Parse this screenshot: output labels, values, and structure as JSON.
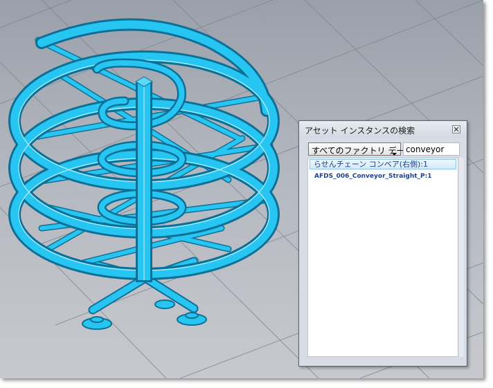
{
  "dialog": {
    "title": "アセット インスタンスの検索",
    "close_icon": "close-icon"
  },
  "filter": {
    "selected": "すべてのファクトリ データ",
    "dropdown_icon": "chevron-down-icon"
  },
  "search": {
    "value": "conveyor"
  },
  "results": [
    {
      "label": "らせんチェーン コンベア(右側):1",
      "selected": true
    },
    {
      "label": "AFDS_006_Conveyor_Straight_P:1",
      "selected": false
    }
  ],
  "viewport": {
    "background_colors": [
      "#9aa0aa",
      "#c7c9ce"
    ],
    "grid_color": "#7f848d",
    "highlight_color": "#27c6f2",
    "edge_color": "#0d6f96"
  }
}
